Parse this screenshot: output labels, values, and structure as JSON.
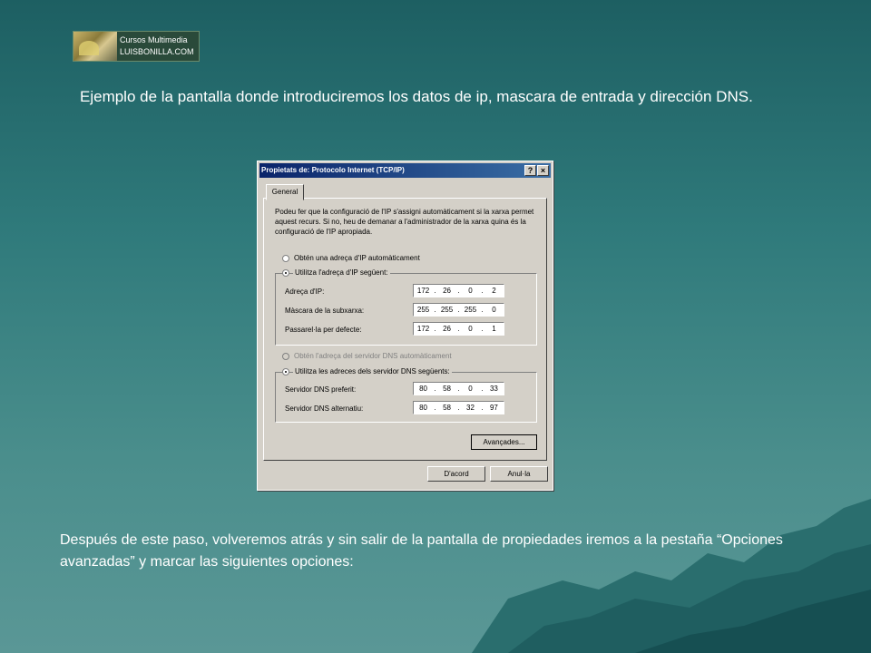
{
  "logo": {
    "line1": "Cursos Multimedia",
    "line2": "LUISBONILLA.COM"
  },
  "intro_text": "Ejemplo de la pantalla donde introduciremos los datos de ip, mascara de entrada y dirección DNS.",
  "dialog": {
    "title": "Propietats de: Protocolo Internet (TCP/IP)",
    "help_label": "?",
    "close_label": "×",
    "tab": "General",
    "description": "Podeu fer que la configuració de l'IP s'assigni automàticament si la xarxa permet aquest recurs. Si no, heu de demanar a l'administrador de la xarxa quina és la configuració de l'IP apropiada.",
    "ip_auto_label": "Obtén una adreça d'IP automàticament",
    "ip_manual_label": "Utilitza l'adreça d'IP següent:",
    "ip_fields": [
      {
        "label": "Adreça d'IP:",
        "octets": [
          "172",
          "26",
          "0",
          "2"
        ]
      },
      {
        "label": "Màscara de la subxarxa:",
        "octets": [
          "255",
          "255",
          "255",
          "0"
        ]
      },
      {
        "label": "Passarel·la per defecte:",
        "octets": [
          "172",
          "26",
          "0",
          "1"
        ]
      }
    ],
    "dns_auto_label": "Obtén l'adreça del servidor DNS automàticament",
    "dns_manual_label": "Utilitza les adreces dels servidor DNS següents:",
    "dns_fields": [
      {
        "label": "Servidor DNS preferit:",
        "octets": [
          "80",
          "58",
          "0",
          "33"
        ]
      },
      {
        "label": "Servidor DNS alternatiu:",
        "octets": [
          "80",
          "58",
          "32",
          "97"
        ]
      }
    ],
    "advanced_button": "Avançades...",
    "ok_button": "D'acord",
    "cancel_button": "Anul·la"
  },
  "bottom_text": "Después de este paso, volveremos atrás y sin salir de la pantalla de propiedades iremos a la pestaña “Opciones avanzadas” y marcar las siguientes opciones:"
}
